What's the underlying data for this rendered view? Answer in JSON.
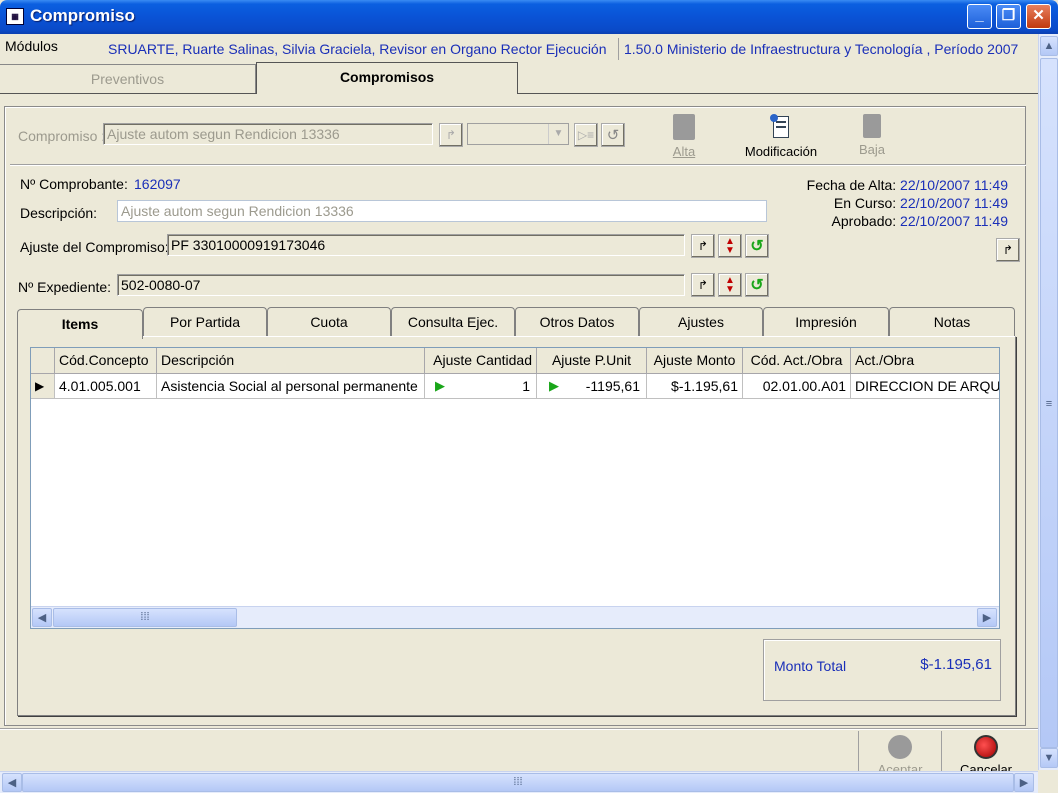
{
  "window": {
    "title": "Compromiso",
    "icon": "app-icon"
  },
  "info_bar": {
    "modules_label": "Módulos",
    "user": "SRUARTE, Ruarte Salinas, Silvia Graciela, Revisor en Organo Rector Ejecución",
    "context": "1.50.0 Ministerio de Infraestructura y Tecnología , Período 2007"
  },
  "top_tabs": [
    {
      "label": "Preventivos",
      "active": false
    },
    {
      "label": "Compromisos",
      "active": true
    }
  ],
  "toolbar": {
    "compromiso_label": "Compromiso :",
    "compromiso_value": "Ajuste autom segun Rendicion 13336",
    "alta_label": "Alta",
    "modificacion_label": "Modificación",
    "baja_label": "Baja"
  },
  "form": {
    "comprobante_label": "Nº Comprobante:",
    "comprobante_value": "162097",
    "descripcion_label": "Descripción:",
    "descripcion_value": "Ajuste autom segun Rendicion 13336",
    "ajuste_label": "Ajuste del Compromiso:",
    "ajuste_value": "PF 33010000919173046",
    "expediente_label": "Nº Expediente:",
    "expediente_value": "502-0080-07",
    "fecha_alta_label": "Fecha de Alta:",
    "fecha_alta_value": "22/10/2007 11:49",
    "en_curso_label": "En Curso:",
    "en_curso_value": "22/10/2007 11:49",
    "aprobado_label": "Aprobado:",
    "aprobado_value": "22/10/2007 11:49"
  },
  "inner_tabs": [
    {
      "label": "Items",
      "active": true
    },
    {
      "label": "Por Partida"
    },
    {
      "label": "Cuota"
    },
    {
      "label": "Consulta Ejec."
    },
    {
      "label": "Otros Datos"
    },
    {
      "label": "Ajustes"
    },
    {
      "label": "Impresión"
    },
    {
      "label": "Notas"
    }
  ],
  "grid": {
    "columns": [
      "Cód.Concepto",
      "Descripción",
      "Ajuste Cantidad",
      "Ajuste P.Unit",
      "Ajuste Monto",
      "Cód. Act./Obra",
      "Act./Obra"
    ],
    "rows": [
      [
        "4.01.005.001",
        "Asistencia Social al personal permanente",
        "1",
        "-1195,61",
        "$-1.195,61",
        "02.01.00.A01",
        "DIRECCION DE ARQU"
      ]
    ]
  },
  "total": {
    "label": "Monto Total",
    "value": "$-1.195,61"
  },
  "footer": {
    "aceptar_label": "Aceptar",
    "cancelar_label": "Cancelar"
  },
  "colors": {
    "accent_blue": "#1a2fb8",
    "title_blue": "#0a53d6",
    "green_play": "#1aa61a",
    "cancel_red": "#c00000"
  }
}
